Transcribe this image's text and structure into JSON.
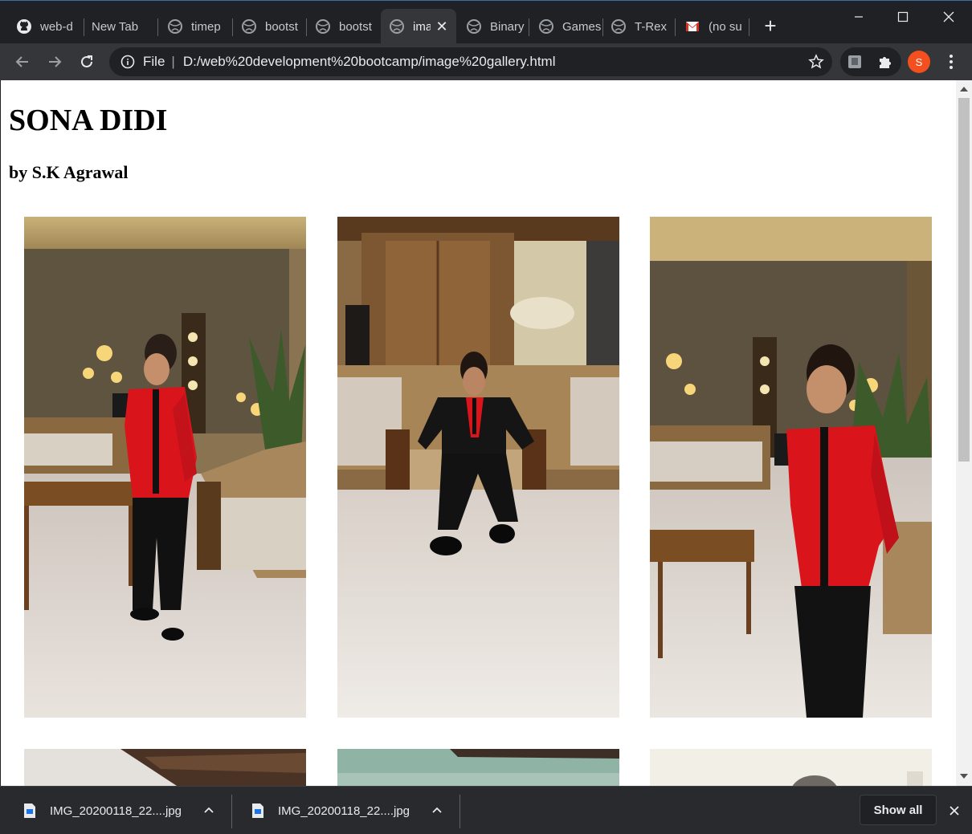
{
  "browser": {
    "tabs": [
      {
        "title": "web-d",
        "icon": "github-icon"
      },
      {
        "title": "New Tab",
        "icon": ""
      },
      {
        "title": "timep",
        "icon": "globe-icon"
      },
      {
        "title": "bootst",
        "icon": "globe-icon"
      },
      {
        "title": "bootst",
        "icon": "globe-icon"
      },
      {
        "title": "ima",
        "icon": "globe-icon",
        "active": true
      },
      {
        "title": "Binary",
        "icon": "globe-icon"
      },
      {
        "title": "Games",
        "icon": "globe-icon"
      },
      {
        "title": "T-Rex",
        "icon": "globe-icon"
      },
      {
        "title": "(no su",
        "icon": "gmail-icon"
      }
    ],
    "omnibox": {
      "scheme_label": "File",
      "url": "D:/web%20development%20bootcamp/image%20gallery.html"
    },
    "profile_initial": "S",
    "colors": {
      "frame": "#202124",
      "toolbar": "#35363a",
      "profile": "#f44f1f"
    }
  },
  "page": {
    "title": "SONA DIDI",
    "subtitle": "by S.K Agrawal",
    "photos": [
      {
        "name": "standing-portrait-left"
      },
      {
        "name": "seated-portrait"
      },
      {
        "name": "standing-portrait-right"
      },
      {
        "name": "partial-photo-4"
      },
      {
        "name": "partial-photo-5"
      },
      {
        "name": "partial-photo-6"
      }
    ]
  },
  "downloads": {
    "items": [
      {
        "filename": "IMG_20200118_22....jpg"
      },
      {
        "filename": "IMG_20200118_22....jpg"
      }
    ],
    "show_all_label": "Show all"
  }
}
